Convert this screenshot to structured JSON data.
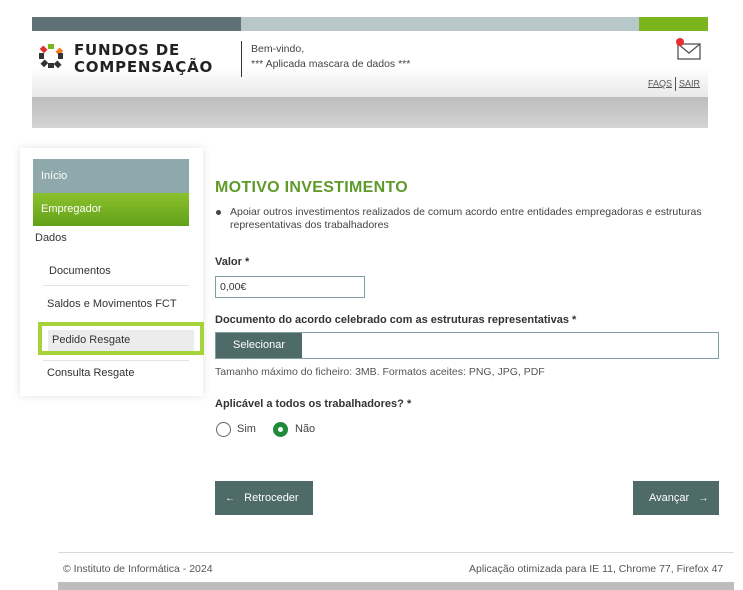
{
  "header": {
    "logo_line1": "FUNDOS DE",
    "logo_line2": "COMPENSAÇÃO",
    "welcome_title": "Bem-vindo,",
    "welcome_user": "*** Aplicada mascara de dados ***",
    "link_faqs": "FAQS",
    "link_sair": "SAIR"
  },
  "sidebar": {
    "inicio": "Início",
    "empregador": "Empregador",
    "dados": "Dados",
    "documentos": "Documentos",
    "saldos": "Saldos e Movimentos FCT",
    "pedido": "Pedido Resgate",
    "consulta": "Consulta Resgate"
  },
  "main": {
    "title": "MOTIVO INVESTIMENTO",
    "bullet": "Apoiar outros investimentos realizados de comum acordo entre entidades empregadoras e estruturas representativas dos trabalhadores",
    "valor_label": "Valor *",
    "valor_value": "0,00€",
    "doc_label": "Documento do acordo celebrado com as estruturas representativas *",
    "select_button": "Selecionar",
    "file_hint": "Tamanho máximo do ficheiro: 3MB. Formatos aceites: PNG, JPG, PDF",
    "aplic_label": "Aplicável a todos os trabalhadores? *",
    "radio_sim": "Sim",
    "radio_nao": "Não",
    "back_button": "Retroceder",
    "next_button": "Avançar"
  },
  "footer": {
    "left": "© Instituto de Informática - 2024",
    "right": "Aplicação otimizada para IE 11, Chrome 77, Firefox 47"
  },
  "colors": {
    "accent_green": "#7ab51d",
    "title_green": "#5e9b2a",
    "button_teal": "#4e6b69",
    "highlight": "#a6d33a"
  }
}
